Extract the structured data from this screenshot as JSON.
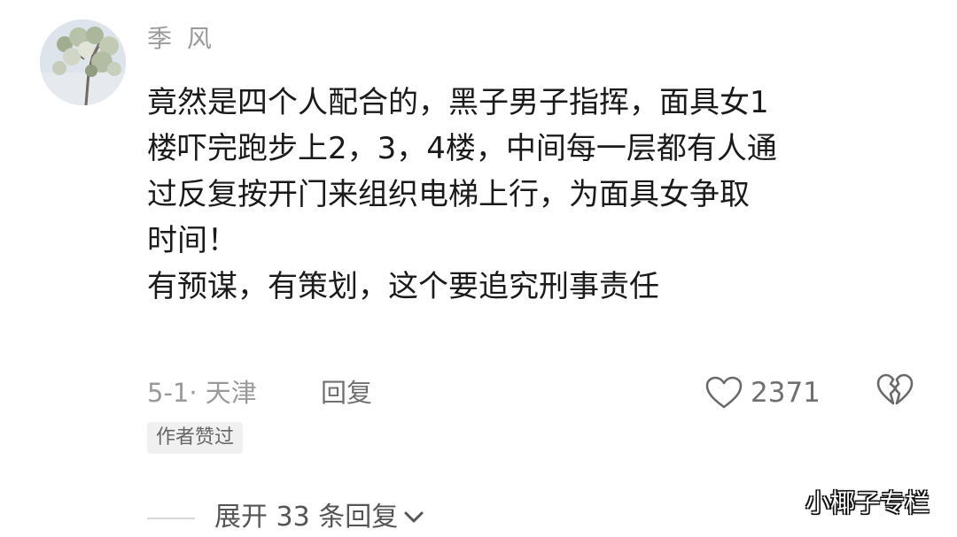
{
  "user": {
    "name": "季 风"
  },
  "comment": {
    "lines": [
      "竟然是四个人配合的，黑子男子指挥，面具女1",
      "楼吓完跑步上2，3，4楼，中间每一层都有人通",
      "过反复按开门来组织电梯上行，为面具女争取",
      "时间！",
      "有预谋，有策划，这个要追究刑事责任"
    ]
  },
  "meta": {
    "date_location": "5-1· 天津",
    "reply_label": "回复",
    "like_count": "2371"
  },
  "badge": {
    "label": "作者赞过"
  },
  "replies": {
    "expand_label": "展开 33 条回复"
  },
  "watermark": {
    "text": "小椰子专栏"
  },
  "icons": {
    "like": "heart-outline-icon",
    "dislike": "broken-heart-icon",
    "expand": "chevron-down-icon"
  },
  "colors": {
    "text_primary": "#1a1a1a",
    "text_secondary": "#9a9a9a",
    "badge_bg": "#f0f0f0"
  }
}
